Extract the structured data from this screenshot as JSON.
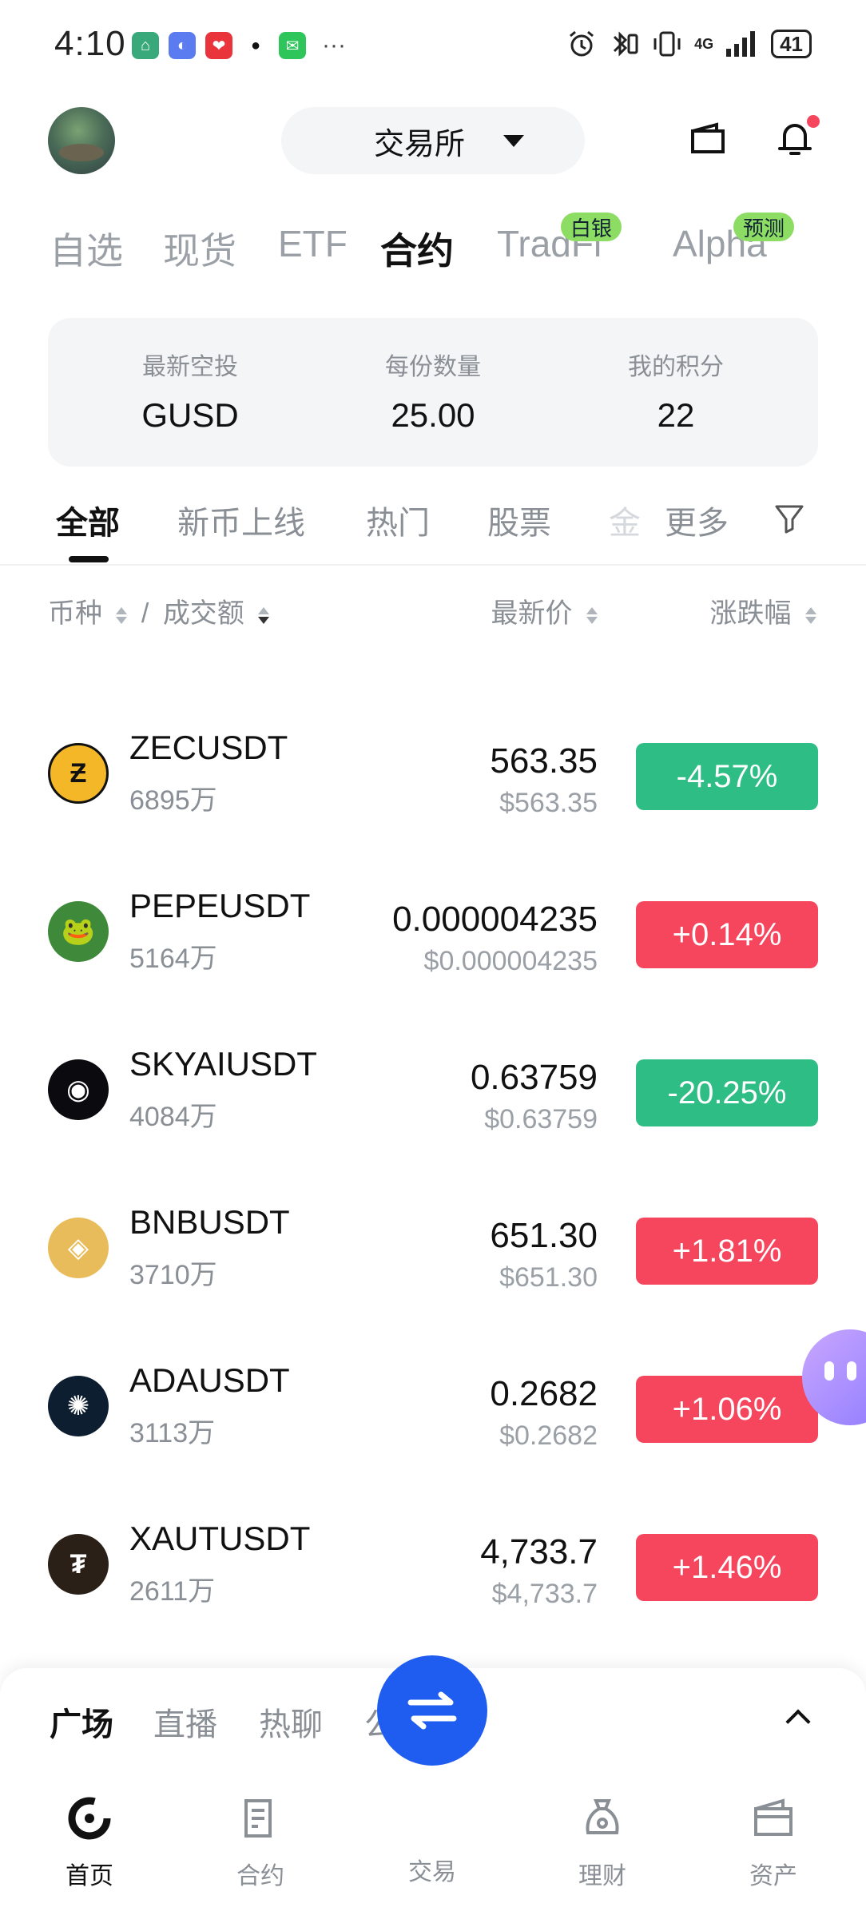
{
  "status_bar": {
    "time": "4:10",
    "network": "4G",
    "battery": "41"
  },
  "header": {
    "exchange_label": "交易所"
  },
  "category_tabs": [
    {
      "label": "自选"
    },
    {
      "label": "现货"
    },
    {
      "label": "ETF"
    },
    {
      "label": "合约",
      "active": true
    },
    {
      "label": "TradFi",
      "badge": "白银"
    },
    {
      "label": "Alpha",
      "badge": "预测"
    }
  ],
  "airdrop": [
    {
      "label": "最新空投",
      "value": "GUSD"
    },
    {
      "label": "每份数量",
      "value": "25.00"
    },
    {
      "label": "我的积分",
      "value": "22"
    }
  ],
  "sub_tabs": [
    {
      "label": "全部",
      "active": true
    },
    {
      "label": "新币上线"
    },
    {
      "label": "热门"
    },
    {
      "label": "股票"
    },
    {
      "label": "金"
    },
    {
      "label": "更多"
    }
  ],
  "list_header": {
    "coin": "币种",
    "separator": "/",
    "volume": "成交额",
    "price": "最新价",
    "change": "涨跌幅"
  },
  "rows": [
    {
      "symbol": "ZECUSDT",
      "volume": "6895万",
      "price": "563.35",
      "usd": "$563.35",
      "change": "-4.57%",
      "dir": "down",
      "icon_color": "#f4b728",
      "icon_glyph": "Ƶ"
    },
    {
      "symbol": "PEPEUSDT",
      "volume": "5164万",
      "price": "0.000004235",
      "usd": "$0.000004235",
      "change": "+0.14%",
      "dir": "up",
      "icon_color": "#3f8a3a",
      "icon_glyph": "🐸"
    },
    {
      "symbol": "SKYAIUSDT",
      "volume": "4084万",
      "price": "0.63759",
      "usd": "$0.63759",
      "change": "-20.25%",
      "dir": "down",
      "icon_color": "#0b0b0f",
      "icon_glyph": "◉"
    },
    {
      "symbol": "BNBUSDT",
      "volume": "3710万",
      "price": "651.30",
      "usd": "$651.30",
      "change": "+1.81%",
      "dir": "up",
      "icon_color": "#e8bc5a",
      "icon_glyph": "◈"
    },
    {
      "symbol": "ADAUSDT",
      "volume": "3113万",
      "price": "0.2682",
      "usd": "$0.2682",
      "change": "+1.06%",
      "dir": "up",
      "icon_color": "#0d1e30",
      "icon_glyph": "✺"
    },
    {
      "symbol": "XAUTUSDT",
      "volume": "2611万",
      "price": "4,733.7",
      "usd": "$4,733.7",
      "change": "+1.46%",
      "dir": "up",
      "icon_color": "#2a2018",
      "icon_glyph": "₮"
    }
  ],
  "feed_tabs": [
    {
      "label": "广场",
      "active": true
    },
    {
      "label": "直播"
    },
    {
      "label": "热聊"
    },
    {
      "label": "公告"
    }
  ],
  "bottom_nav": [
    {
      "label": "首页",
      "icon": "home-icon",
      "active": true
    },
    {
      "label": "合约",
      "icon": "contract-icon"
    },
    {
      "label": "交易",
      "icon": "swap-icon"
    },
    {
      "label": "理财",
      "icon": "earn-icon"
    },
    {
      "label": "资产",
      "icon": "wallet-icon"
    }
  ],
  "colors": {
    "up": "#f6465d",
    "down": "#2ebd85",
    "accent": "#1f5df0",
    "badge": "#8ddc64"
  }
}
